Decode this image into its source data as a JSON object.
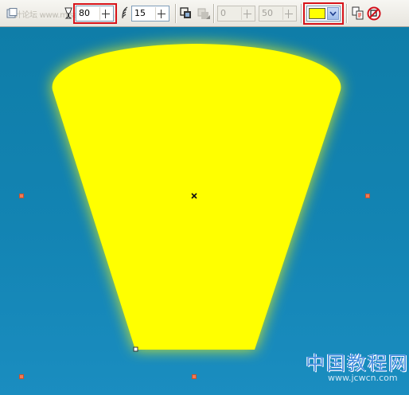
{
  "toolbar": {
    "faint_label": "设计论坛  www.missyuan.com",
    "opacity_value": "80",
    "feather_value": "15",
    "offset_x_value": "0",
    "offset_y_value": "50",
    "glow_color": "#ffff00"
  },
  "canvas": {
    "shape_fill": "#ffff00",
    "background": "#1386b4"
  },
  "watermark": {
    "text": "中国教程网",
    "url": "www.jcwcn.com"
  }
}
